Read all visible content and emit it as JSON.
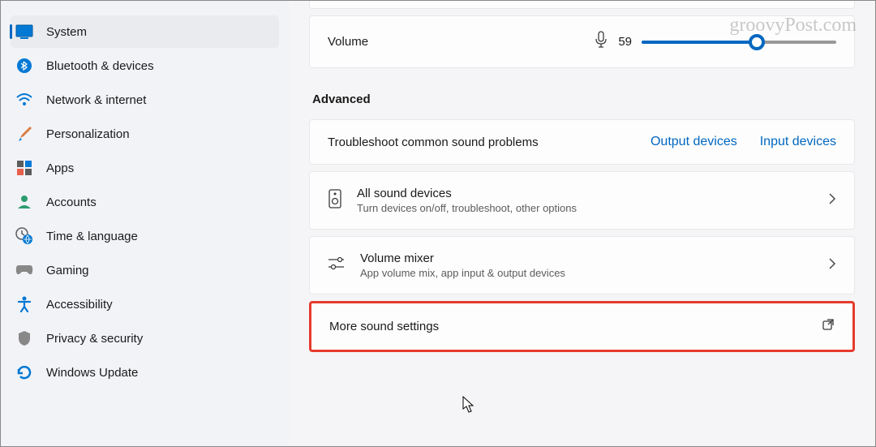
{
  "watermark": "groovyPost.com",
  "sidebar": {
    "items": [
      {
        "label": "System"
      },
      {
        "label": "Bluetooth & devices"
      },
      {
        "label": "Network & internet"
      },
      {
        "label": "Personalization"
      },
      {
        "label": "Apps"
      },
      {
        "label": "Accounts"
      },
      {
        "label": "Time & language"
      },
      {
        "label": "Gaming"
      },
      {
        "label": "Accessibility"
      },
      {
        "label": "Privacy & security"
      },
      {
        "label": "Windows Update"
      }
    ]
  },
  "volume": {
    "label": "Volume",
    "value": "59"
  },
  "advanced": {
    "heading": "Advanced",
    "troubleshoot": {
      "title": "Troubleshoot common sound problems",
      "output_link": "Output devices",
      "input_link": "Input devices"
    },
    "all_devices": {
      "title": "All sound devices",
      "subtitle": "Turn devices on/off, troubleshoot, other options"
    },
    "mixer": {
      "title": "Volume mixer",
      "subtitle": "App volume mix, app input & output devices"
    },
    "more": {
      "title": "More sound settings"
    }
  }
}
